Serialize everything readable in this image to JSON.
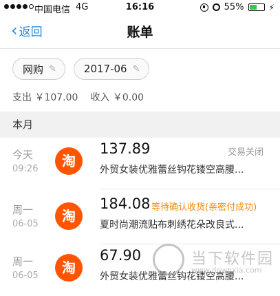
{
  "status_bar": {
    "carrier": "中国电信",
    "network": "4G",
    "time": "16:16",
    "battery_percent": "55%",
    "battery_level": 0.55,
    "signal_bars_filled": 4,
    "signal_bars_total": 5
  },
  "nav": {
    "back_label": "返回",
    "title": "账单"
  },
  "filters": {
    "category": "网购",
    "month": "2017-06"
  },
  "summary": {
    "expense": "支出 ￥107.00",
    "income": "收入 ￥0.00"
  },
  "section": {
    "label": "本月"
  },
  "transactions": [
    {
      "day": "今天",
      "time": "09:26",
      "logo": "淘",
      "amount": "137.89",
      "status": "交易关闭",
      "description": "外贸女装优雅蕾丝钩花镂空高腰..."
    },
    {
      "day": "周一",
      "time": "06-05",
      "logo": "淘",
      "amount": "184.08",
      "status": "等待确认收货(亲密付成功)",
      "description": "夏时尚潮流贴布刺绣花朵改良式..."
    },
    {
      "day": "周一",
      "time": "06-05",
      "logo": "淘",
      "amount": "67.90",
      "status": "",
      "description": "外贸女装优雅蕾丝钩花镂空高腰..."
    }
  ],
  "watermark": {
    "text": "当下软件园",
    "url": "www.downxia.com"
  },
  "colors": {
    "accent": "#1e88e5",
    "taobao": "#ff5500",
    "status_orange": "#f08a00",
    "battery_green": "#2fc94a"
  }
}
